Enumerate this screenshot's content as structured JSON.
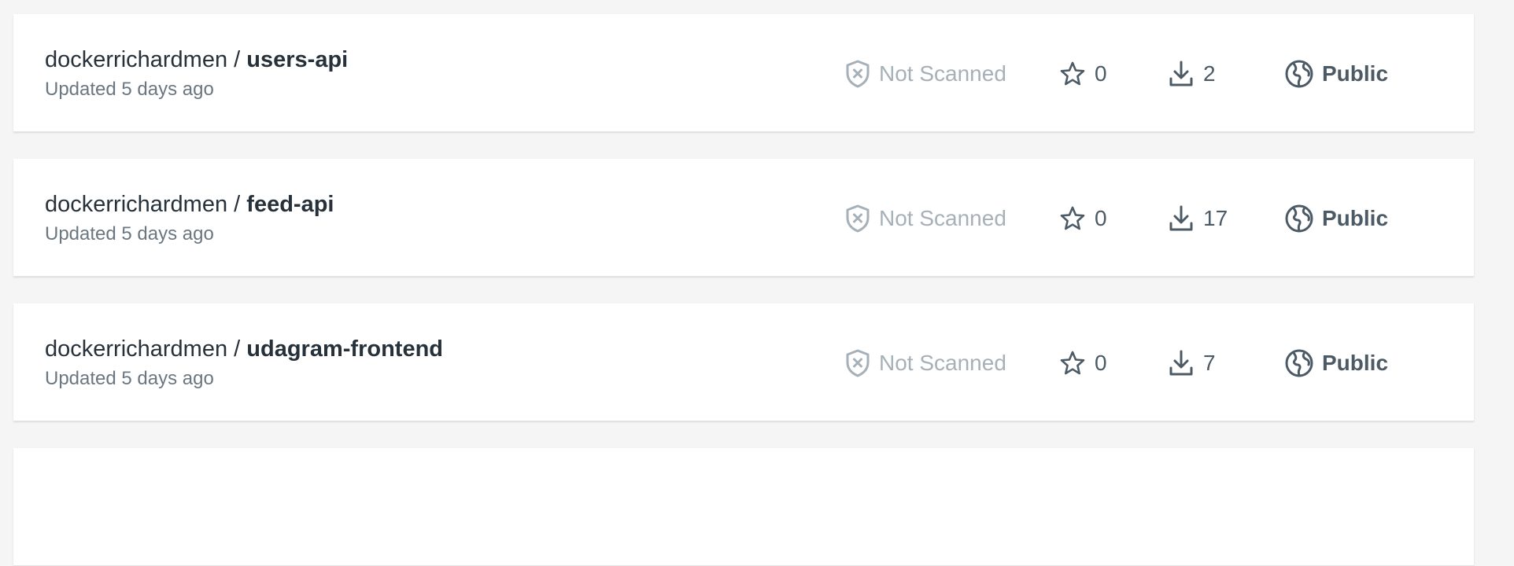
{
  "colors": {
    "background": "#f5f5f5",
    "card": "#ffffff",
    "text_primary": "#27313a",
    "text_secondary": "#6b7780",
    "not_scanned": "#a6b0b8",
    "meta_icon": "#4b5a65"
  },
  "icons": {
    "scan": "shield-x-icon",
    "stars": "star-icon",
    "pulls": "download-icon",
    "visibility": "globe-icon"
  },
  "repositories": [
    {
      "namespace": "dockerrichardmen",
      "separator": " / ",
      "name": "users-api",
      "updated": "Updated 5 days ago",
      "scan_status": "Not Scanned",
      "stars": "0",
      "pulls": "2",
      "visibility": "Public"
    },
    {
      "namespace": "dockerrichardmen",
      "separator": " / ",
      "name": "feed-api",
      "updated": "Updated 5 days ago",
      "scan_status": "Not Scanned",
      "stars": "0",
      "pulls": "17",
      "visibility": "Public"
    },
    {
      "namespace": "dockerrichardmen",
      "separator": " / ",
      "name": "udagram-frontend",
      "updated": "Updated 5 days ago",
      "scan_status": "Not Scanned",
      "stars": "0",
      "pulls": "7",
      "visibility": "Public"
    }
  ]
}
